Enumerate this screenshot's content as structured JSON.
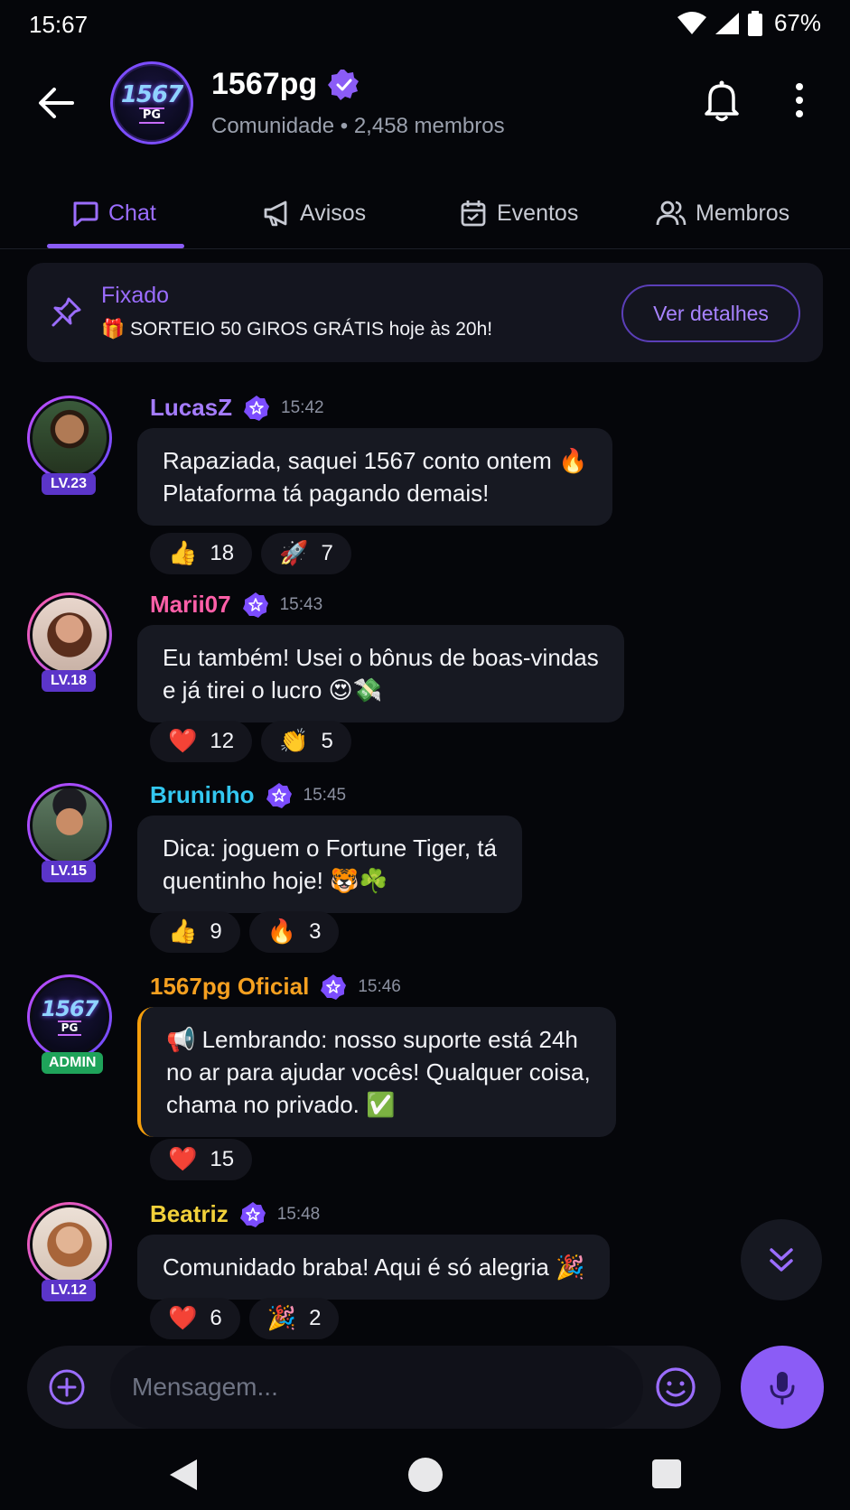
{
  "status": {
    "time": "15:67",
    "battery": "67%"
  },
  "header": {
    "logo_num": "1567",
    "logo_pg": "PG",
    "title": "1567pg",
    "subtitle": "Comunidade • 2,458 membros"
  },
  "tabs": [
    {
      "label": "Chat",
      "icon": "chat-bubble-icon",
      "active": true
    },
    {
      "label": "Avisos",
      "icon": "megaphone-icon"
    },
    {
      "label": "Eventos",
      "icon": "calendar-icon"
    },
    {
      "label": "Membros",
      "icon": "people-icon"
    }
  ],
  "pinned": {
    "label": "Fixado",
    "text": "🎁 SORTEIO 50 GIROS GRÁTIS hoje às 20h!",
    "button": "Ver detalhes"
  },
  "messages": [
    {
      "name": "LucasZ",
      "name_color": "#a57cff",
      "time": "15:42",
      "badge": "LV.23",
      "lines": [
        "Rapaziada, saquei 1567 conto ontem 🔥",
        "Plataforma tá pagando demais!"
      ],
      "reactions": [
        {
          "emoji": "👍",
          "count": "18"
        },
        {
          "emoji": "🚀",
          "count": "7"
        }
      ]
    },
    {
      "name": "Marii07",
      "name_color": "#ff5fa8",
      "time": "15:43",
      "badge": "LV.18",
      "lines": [
        "Eu também! Usei o bônus de boas-vindas",
        "e já tirei o lucro 😍💸"
      ],
      "reactions": [
        {
          "emoji": "❤️",
          "count": "12"
        },
        {
          "emoji": "👏",
          "count": "5"
        }
      ]
    },
    {
      "name": "Bruninho",
      "name_color": "#33c7f0",
      "time": "15:45",
      "badge": "LV.15",
      "lines": [
        "Dica: joguem o Fortune Tiger, tá",
        "quentinho hoje! 🐯☘️"
      ],
      "reactions": [
        {
          "emoji": "👍",
          "count": "9"
        },
        {
          "emoji": "🔥",
          "count": "3"
        }
      ]
    },
    {
      "name": "1567pg Oficial",
      "name_color": "#f5a020",
      "time": "15:46",
      "badge": "ADMIN",
      "lines": [
        "📢 Lembrando: nosso suporte está 24h",
        "no ar para ajudar vocês! Qualquer coisa,",
        "chama no privado. ✅"
      ],
      "reactions": [
        {
          "emoji": "❤️",
          "count": "15"
        }
      ]
    },
    {
      "name": "Beatriz",
      "name_color": "#f2d13a",
      "time": "15:48",
      "badge": "LV.12",
      "lines": [
        "Comunidado braba! Aqui é só alegria 🎉"
      ],
      "reactions": [
        {
          "emoji": "❤️",
          "count": "6"
        },
        {
          "emoji": "🎉",
          "count": "2"
        }
      ]
    }
  ],
  "composer": {
    "placeholder": "Mensagem..."
  },
  "colors": {
    "accent": "#8b5cf6",
    "background": "#05060a",
    "bubble": "#171922"
  }
}
